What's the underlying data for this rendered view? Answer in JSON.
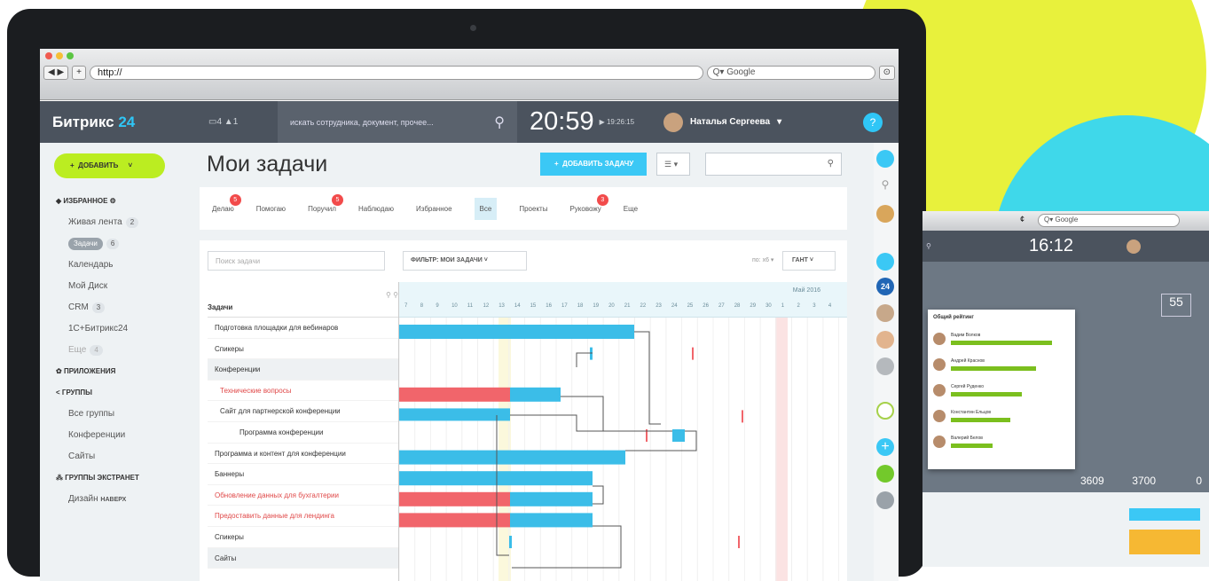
{
  "browser": {
    "url": "http://",
    "search_placeholder": "Google"
  },
  "topbar": {
    "logo_main": "Битрикс",
    "logo_num": "24",
    "notif_text": "4 ▲1",
    "search_placeholder": "искать сотрудника, документ, прочее...",
    "time": "20:59",
    "time_sub": "19:26:15",
    "user_name": "Наталья Сергеева",
    "help": "?"
  },
  "leftnav": {
    "add_label": "ДОБАВИТЬ",
    "favorites": "ИЗБРАННОЕ",
    "items": [
      {
        "label": "Живая лента",
        "count": "2"
      },
      {
        "label": "Задачи",
        "count": "6"
      },
      {
        "label": "Календарь",
        "count": ""
      },
      {
        "label": "Мой Диск",
        "count": ""
      },
      {
        "label": "CRM",
        "count": "3"
      },
      {
        "label": "1С+Битрикс24",
        "count": ""
      },
      {
        "label": "Еще",
        "count": "4"
      }
    ],
    "apps": "ПРИЛОЖЕНИЯ",
    "groups": "ГРУППЫ",
    "group_items": [
      "Все группы",
      "Конференции",
      "Сайты"
    ],
    "extranet": "ГРУППЫ ЭКСТРАНЕТ",
    "design": "Дизайн",
    "up": "НАВЕРХ"
  },
  "main": {
    "title": "Мои задачи",
    "add_task": "ДОБАВИТЬ ЗАДАЧУ",
    "tabs": [
      {
        "label": "Делаю",
        "badge": "5"
      },
      {
        "label": "Помогаю",
        "badge": ""
      },
      {
        "label": "Поручил",
        "badge": "5"
      },
      {
        "label": "Наблюдаю",
        "badge": ""
      },
      {
        "label": "Избранное",
        "badge": ""
      },
      {
        "label": "Все",
        "badge": ""
      },
      {
        "label": "Проекты",
        "badge": ""
      },
      {
        "label": "Руковожу",
        "badge": "3"
      },
      {
        "label": "Еще",
        "badge": ""
      }
    ],
    "task_search_placeholder": "Поиск задачи",
    "filter_label": "ФИЛЬТР: МОИ ЗАДАЧИ",
    "view_label": "ГАНТ",
    "month_label": "Май 2016",
    "tasks_header": "Задачи",
    "tasks": [
      {
        "label": "Подготовка площадки для вебинаров",
        "style": "normal"
      },
      {
        "label": "Спикеры",
        "style": "normal"
      },
      {
        "label": "Конференции",
        "style": "group"
      },
      {
        "label": "Технические вопросы",
        "style": "red"
      },
      {
        "label": "Сайт для партнерской конференции",
        "style": "normal"
      },
      {
        "label": "Программа конференции",
        "style": "normal"
      },
      {
        "label": "Программа и контент для конференции",
        "style": "normal"
      },
      {
        "label": "Баннеры",
        "style": "normal"
      },
      {
        "label": "Обновление данных для бухгалтерии",
        "style": "red"
      },
      {
        "label": "Предоставить данные для лендинга",
        "style": "red"
      },
      {
        "label": "Спикеры",
        "style": "normal"
      },
      {
        "label": "Сайты",
        "style": "group"
      }
    ],
    "days": [
      "7",
      "8",
      "9",
      "10",
      "11",
      "12",
      "13",
      "14",
      "15",
      "16",
      "17",
      "18",
      "19",
      "20",
      "21",
      "22",
      "23",
      "24",
      "25",
      "26",
      "27",
      "28",
      "29",
      "30",
      "1",
      "2",
      "3",
      "4"
    ]
  },
  "second_screen": {
    "time": "16:12",
    "search_placeholder": "Google",
    "popup_title": "Общий рейтинг",
    "people": [
      {
        "name": "Вадим Волков",
        "value": 0.85
      },
      {
        "name": "Андрей Краснов",
        "value": 0.72
      },
      {
        "name": "Сергей Руденко",
        "value": 0.6
      },
      {
        "name": "Константин Ельцов",
        "value": 0.5
      },
      {
        "name": "Валерий Белов",
        "value": 0.35
      }
    ],
    "stat1": "3700",
    "stat2": "0",
    "stat3": "3609",
    "gauge": "55"
  },
  "colors": {
    "accent": "#3bc8f5",
    "add_green": "#bbed21",
    "bar_blue": "#3bbde8",
    "bar_red": "#f1656b"
  }
}
